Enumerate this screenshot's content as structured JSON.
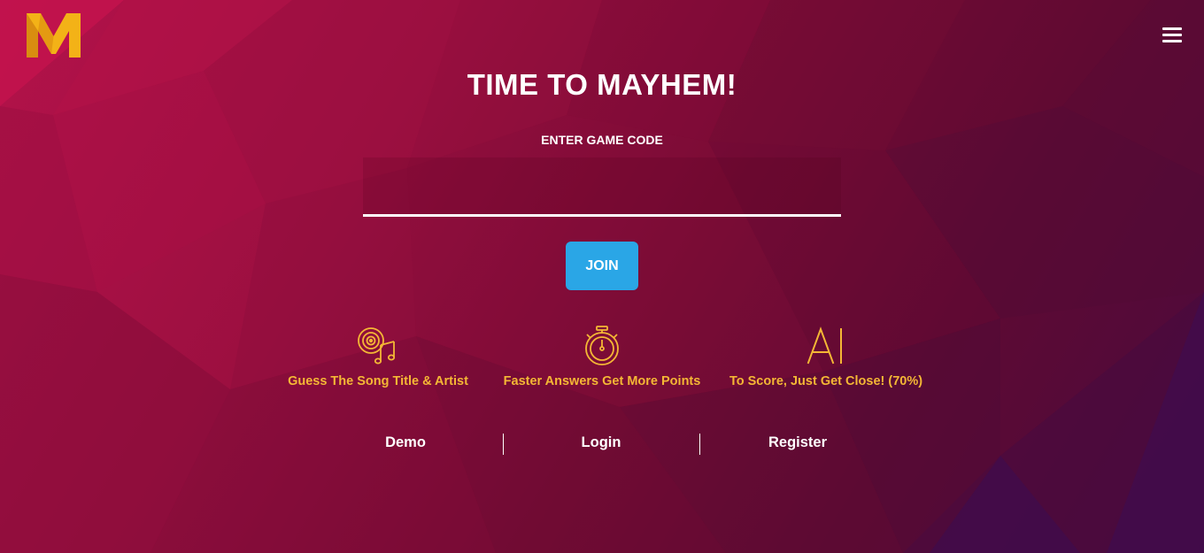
{
  "header": {
    "logo_icon": "mayhem-m-logo",
    "menu_icon": "hamburger-menu-icon"
  },
  "main": {
    "title": "TIME TO MAYHEM!",
    "code_label": "ENTER GAME CODE",
    "code_value": "",
    "join_label": "JOIN"
  },
  "features": [
    {
      "icon": "vinyl-music-note-icon",
      "label": "Guess The Song Title & Artist"
    },
    {
      "icon": "stopwatch-icon",
      "label": "Faster Answers Get More Points"
    },
    {
      "icon": "ai-icon",
      "label": "To Score, Just Get Close! (70%)"
    }
  ],
  "footer_links": [
    {
      "label": "Demo"
    },
    {
      "label": "Login"
    },
    {
      "label": "Register"
    }
  ],
  "colors": {
    "accent_yellow": "#f4b735",
    "join_blue": "#2aa6e6",
    "background_red": "#9c0f40",
    "background_purple": "#4a0a3e"
  }
}
